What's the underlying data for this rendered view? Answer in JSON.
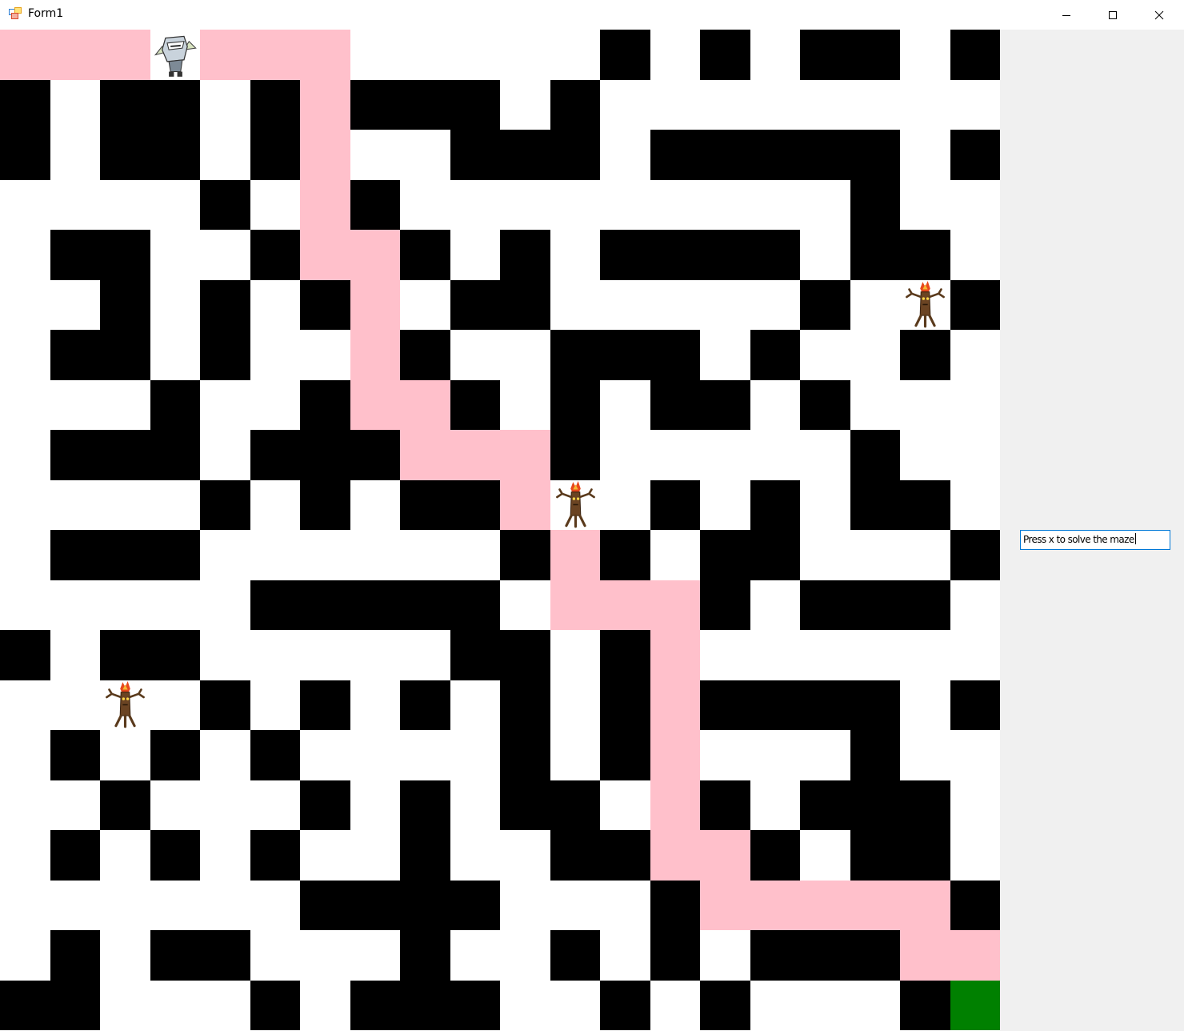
{
  "window": {
    "title": "Form1",
    "buttons": [
      "minimize",
      "maximize",
      "close"
    ]
  },
  "maze": {
    "rows": 20,
    "cols": 20,
    "legend": {
      "#": "wall",
      ".": "open",
      "p": "solution-path",
      "G": "goal"
    },
    "grid": [
      "ppp.ppp.....#.#.##.#",
      "#.##.#p###.#........",
      "#.##.#p..###.#####.#",
      "....#.p#.........#..",
      ".##..#pp#.#.####.##.",
      "..#.#.#p.##.....#..#",
      ".##.#..p#..###.#..#.",
      "...#..#pp#.#.##.#...",
      ".###.###ppp#.....#..",
      "....#.#.##p..#.#.##.",
      ".###......#p#.##...#",
      ".....#####.ppp#.###.",
      "#.##.....##.#p......",
      "....#.#.#.#.#p####.#",
      ".#.#.#....#.#p...#..",
      "..#...#.#.##.p#.###.",
      ".#.#.#..#..##pp#.##.",
      "......####...#ppppp#",
      ".#.##...#..#.#.###pp",
      "##...#.###..#.#...#G"
    ],
    "sprites": [
      {
        "kind": "player-knight",
        "row": 0,
        "col": 3
      },
      {
        "kind": "tree-monster",
        "row": 5,
        "col": 18
      },
      {
        "kind": "tree-monster",
        "row": 9,
        "col": 11
      },
      {
        "kind": "tree-monster",
        "row": 13,
        "col": 2
      }
    ]
  },
  "colors": {
    "wall": "#000000",
    "open": "#ffffff",
    "path": "#ffc0cb",
    "goal": "#008000",
    "side_panel": "#f0f0f0",
    "focus_border": "#0078d7"
  },
  "hint": {
    "value": "Press x to solve the maze"
  }
}
